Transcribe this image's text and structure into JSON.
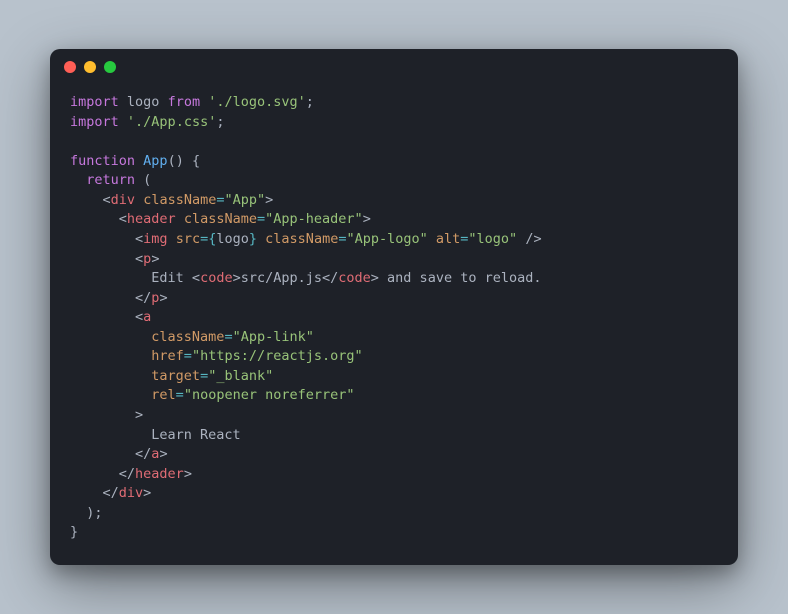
{
  "window": {
    "traffic_lights": [
      "close",
      "minimize",
      "maximize"
    ]
  },
  "code": {
    "l1": {
      "kw1": "import",
      "id1": "logo",
      "kw2": "from",
      "str1": "'./logo.svg'",
      "end": ";"
    },
    "l2": {
      "kw1": "import",
      "str1": "'./App.css'",
      "end": ";"
    },
    "l3": "",
    "l4": {
      "kw1": "function",
      "fn": "App",
      "paren": "()",
      "brace": " {"
    },
    "l5": {
      "kw1": "return",
      "paren": " ("
    },
    "l6": {
      "ind": "    ",
      "lt": "<",
      "tag": "div",
      "sp": " ",
      "attr": "className",
      "eq": "=",
      "val": "\"App\"",
      "gt": ">"
    },
    "l7": {
      "ind": "      ",
      "lt": "<",
      "tag": "header",
      "sp": " ",
      "attr": "className",
      "eq": "=",
      "val": "\"App-header\"",
      "gt": ">"
    },
    "l8": {
      "ind": "        ",
      "lt": "<",
      "tag": "img",
      "sp1": " ",
      "a1": "src",
      "eq1": "=",
      "lb": "{",
      "expr": "logo",
      "rb": "}",
      "sp2": " ",
      "a2": "className",
      "eq2": "=",
      "v2": "\"App-logo\"",
      "sp3": " ",
      "a3": "alt",
      "eq3": "=",
      "v3": "\"logo\"",
      "close": " />"
    },
    "l9": {
      "ind": "        ",
      "lt": "<",
      "tag": "p",
      "gt": ">"
    },
    "l10": {
      "ind": "          ",
      "t1": "Edit ",
      "lt1": "<",
      "tag1": "code",
      "gt1": ">",
      "t2": "src/App.js",
      "lt2": "</",
      "tag2": "code",
      "gt2": ">",
      "t3": " and save to reload."
    },
    "l11": {
      "ind": "        ",
      "lt": "</",
      "tag": "p",
      "gt": ">"
    },
    "l12": {
      "ind": "        ",
      "lt": "<",
      "tag": "a"
    },
    "l13": {
      "ind": "          ",
      "attr": "className",
      "eq": "=",
      "val": "\"App-link\""
    },
    "l14": {
      "ind": "          ",
      "attr": "href",
      "eq": "=",
      "val": "\"https://reactjs.org\""
    },
    "l15": {
      "ind": "          ",
      "attr": "target",
      "eq": "=",
      "val": "\"_blank\""
    },
    "l16": {
      "ind": "          ",
      "attr": "rel",
      "eq": "=",
      "val": "\"noopener noreferrer\""
    },
    "l17": {
      "ind": "        ",
      "gt": ">"
    },
    "l18": {
      "ind": "          ",
      "text": "Learn React"
    },
    "l19": {
      "ind": "        ",
      "lt": "</",
      "tag": "a",
      "gt": ">"
    },
    "l20": {
      "ind": "      ",
      "lt": "</",
      "tag": "header",
      "gt": ">"
    },
    "l21": {
      "ind": "    ",
      "lt": "</",
      "tag": "div",
      "gt": ">"
    },
    "l22": {
      "ind": "  ",
      "paren": ");"
    },
    "l23": {
      "brace": "}"
    }
  }
}
